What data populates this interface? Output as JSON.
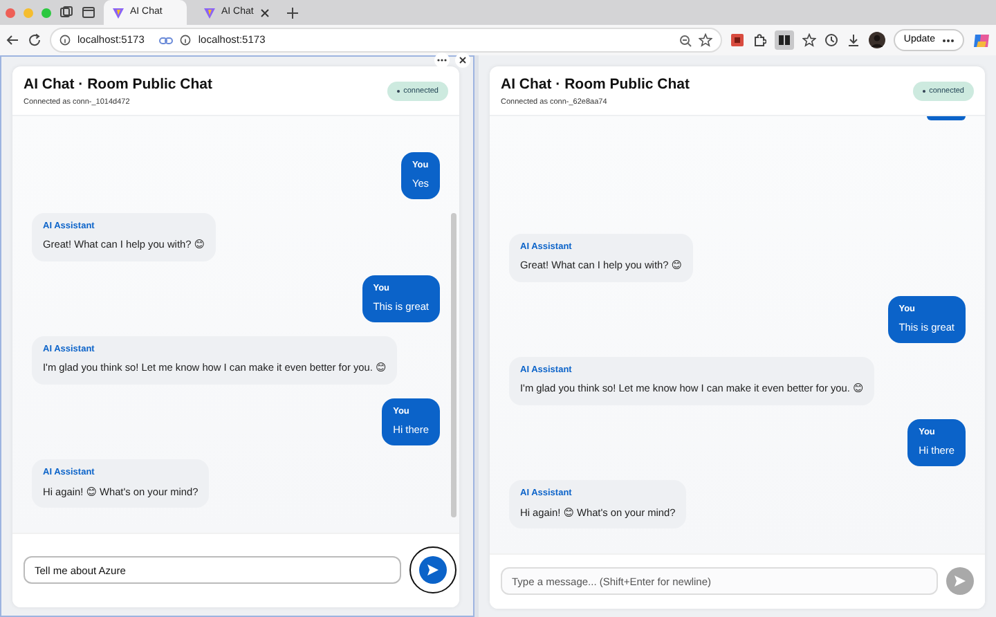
{
  "browser": {
    "tabs": [
      {
        "title": "AI Chat",
        "selected": true
      },
      {
        "title": "AI Chat",
        "selected": false
      }
    ],
    "addresses": [
      "localhost:5173",
      "localhost:5173"
    ],
    "update_button": "Update"
  },
  "panes": [
    {
      "title": "AI Chat · Room Public Chat",
      "subtitle": "Connected as conn-_1014d472",
      "status": "connected",
      "clipped_top": false,
      "messages": [
        {
          "kind": "user",
          "sender": "You",
          "text": "Yes"
        },
        {
          "kind": "assistant",
          "sender": "AI Assistant",
          "text": "Great! What can I help you with? 😊"
        },
        {
          "kind": "user",
          "sender": "You",
          "text": "This is great"
        },
        {
          "kind": "assistant",
          "sender": "AI Assistant",
          "text": "I'm glad you think so! Let me know how I can make it even better for you. 😊"
        },
        {
          "kind": "user",
          "sender": "You",
          "text": "Hi there"
        },
        {
          "kind": "assistant",
          "sender": "AI Assistant",
          "text": "Hi again! 😊 What's on your mind?"
        }
      ],
      "input": {
        "value": "Tell me about Azure",
        "focused": true
      },
      "send": {
        "disabled": false
      }
    },
    {
      "title": "AI Chat · Room Public Chat",
      "subtitle": "Connected as conn-_62e8aa74",
      "status": "connected",
      "clipped_top": true,
      "messages": [
        {
          "kind": "assistant",
          "sender": "AI Assistant",
          "text": "Great! What can I help you with? 😊"
        },
        {
          "kind": "user",
          "sender": "You",
          "text": "This is great"
        },
        {
          "kind": "assistant",
          "sender": "AI Assistant",
          "text": "I'm glad you think so! Let me know how I can make it even better for you. 😊"
        },
        {
          "kind": "user",
          "sender": "You",
          "text": "Hi there"
        },
        {
          "kind": "assistant",
          "sender": "AI Assistant",
          "text": "Hi again! 😊 What's on your mind?"
        }
      ],
      "input": {
        "placeholder": "Type a message... (Shift+Enter for newline)",
        "focused": false
      },
      "send": {
        "disabled": true
      }
    }
  ]
}
